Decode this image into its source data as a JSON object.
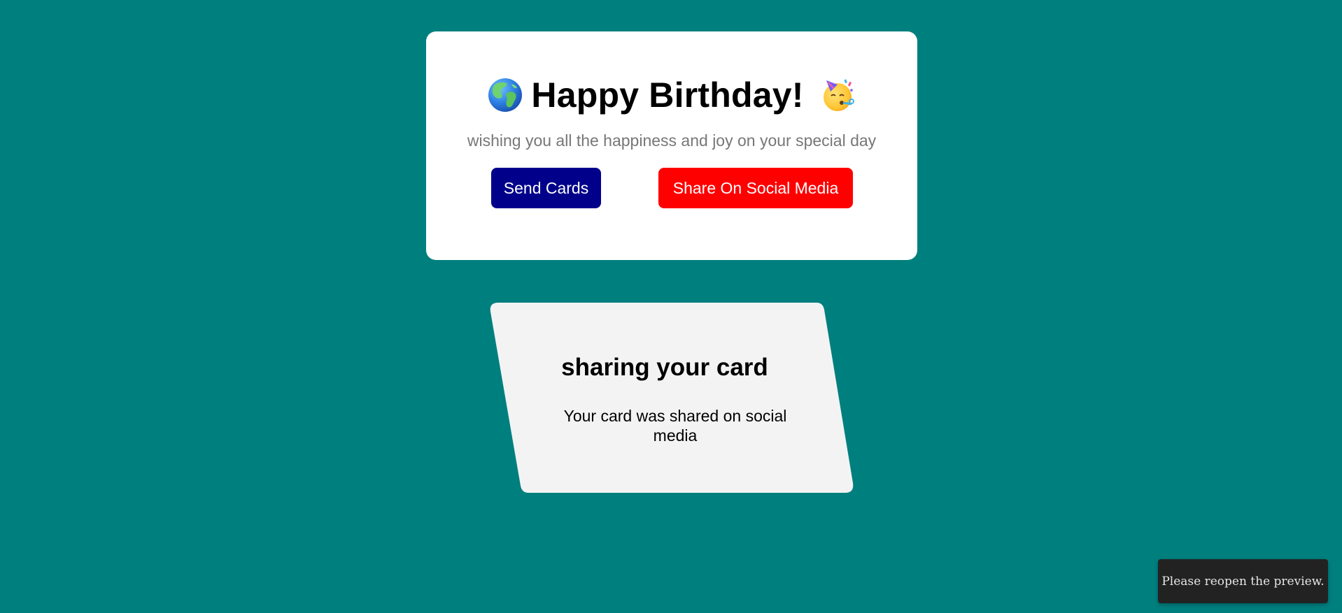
{
  "page": {
    "background_color": "#007f7f"
  },
  "card": {
    "title": "Happy Birthday!",
    "leading_icon": "globe-icon",
    "trailing_icon": "party-face-icon",
    "subtitle": "wishing you all the happiness and joy on your special day",
    "send_button_label": "Send Cards",
    "send_button_color": "#00008b",
    "share_button_label": "Share On Social Media",
    "share_button_color": "#ff0000"
  },
  "notice": {
    "title": "sharing your card",
    "message": "Your card was shared on social media",
    "background_color": "#f3f3f3"
  },
  "toast": {
    "message": "Please reopen the preview."
  }
}
